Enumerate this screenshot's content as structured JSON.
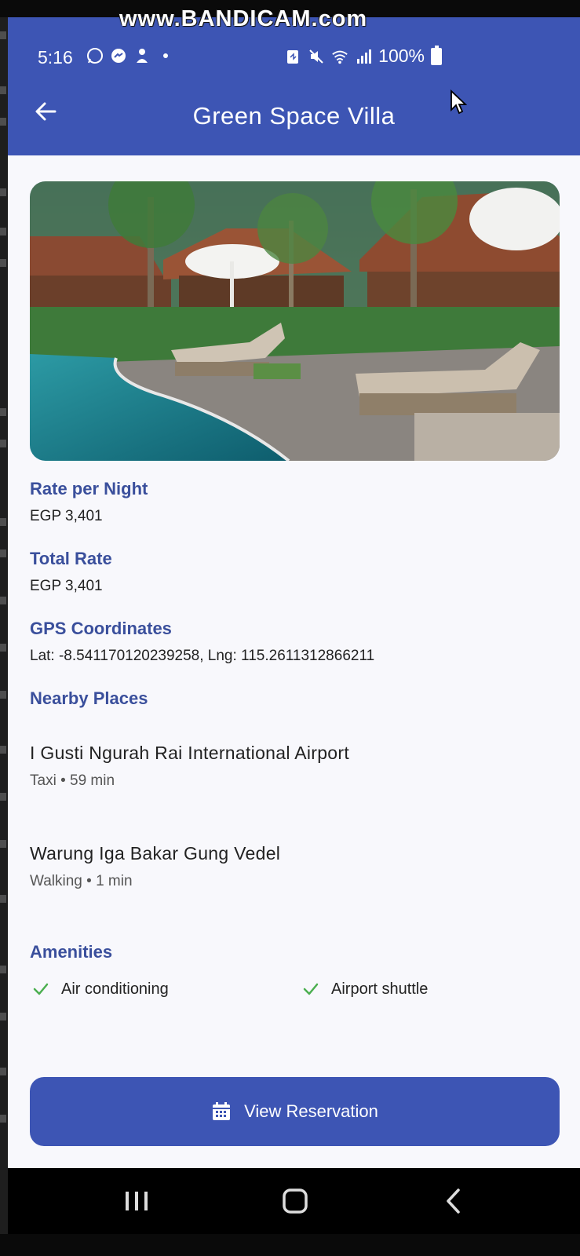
{
  "watermark": "www.BANDICAM.com",
  "status_bar": {
    "time": "5:16",
    "battery": "100%",
    "icons": [
      "whatsapp-icon",
      "messenger-icon",
      "notification-icon",
      "dot-icon",
      "battery-saver-icon",
      "mute-icon",
      "wifi-icon",
      "signal-icon",
      "battery-icon"
    ]
  },
  "app_bar": {
    "title": "Green Space Villa",
    "back_icon": "arrow-left-icon"
  },
  "hero_image": {
    "description_icon": "villa-photo"
  },
  "details": {
    "rate_per_night_label": "Rate per Night",
    "rate_per_night_value": "EGP 3,401",
    "total_rate_label": "Total Rate",
    "total_rate_value": "EGP 3,401",
    "gps_label": "GPS Coordinates",
    "gps_value": "Lat: -8.541170120239258,  Lng: 115.2611312866211"
  },
  "nearby": {
    "label": "Nearby Places",
    "places": [
      {
        "name": "I Gusti Ngurah Rai International Airport",
        "meta": "Taxi • 59 min"
      },
      {
        "name": "Warung Iga Bakar Gung Vedel",
        "meta": "Walking • 1 min"
      }
    ]
  },
  "amenities": {
    "label": "Amenities",
    "items": [
      "Air conditioning",
      "Airport shuttle"
    ],
    "icon": "check-icon",
    "check_color": "#4caf50"
  },
  "cta": {
    "label": "View Reservation",
    "icon": "calendar-icon"
  },
  "nav": {
    "recents_icon": "recents-icon",
    "home_icon": "home-icon",
    "back_icon": "back-chevron-icon"
  },
  "colors": {
    "primary": "#3d55b4",
    "section_label": "#3a4f9c",
    "background": "#f8f8fc"
  }
}
